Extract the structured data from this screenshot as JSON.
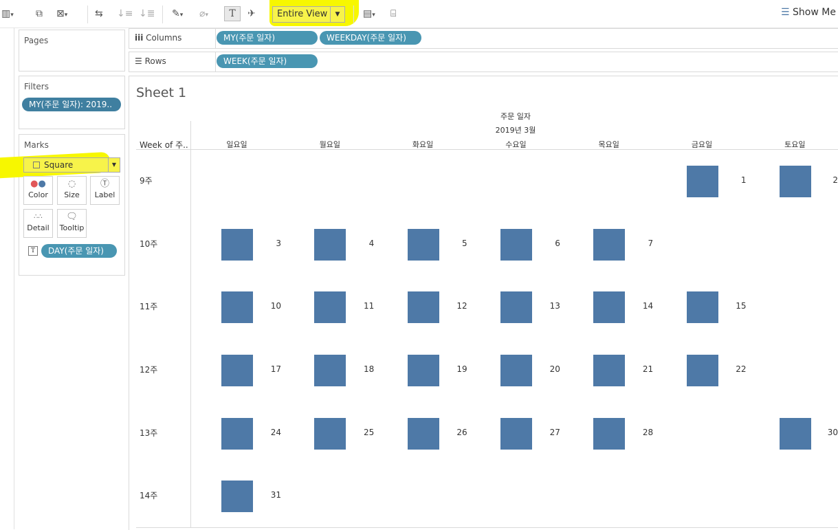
{
  "toolbar": {
    "view_select": "Entire View",
    "show_me": "Show Me",
    "text_icon": "T"
  },
  "pages": {
    "title": "Pages"
  },
  "filters": {
    "title": "Filters",
    "pill": "MY(주문 일자): 2019.."
  },
  "marks": {
    "title": "Marks",
    "type": "Square",
    "buttons": [
      {
        "label": "Color",
        "icon": "color-dots-icon"
      },
      {
        "label": "Size",
        "icon": "size-lasso-icon"
      },
      {
        "label": "Label",
        "icon": "label-T-icon"
      },
      {
        "label": "Detail",
        "icon": "detail-dots-icon"
      },
      {
        "label": "Tooltip",
        "icon": "tooltip-bubble-icon"
      }
    ],
    "label_pill_icon": "T",
    "label_pill": "DAY(주문 일자)"
  },
  "shelves": {
    "columns_label": "Columns",
    "columns": [
      "MY(주문 일자)",
      "WEEKDAY(주문 일자)"
    ],
    "rows_label": "Rows",
    "rows": [
      "WEEK(주문 일자)"
    ]
  },
  "sheet": {
    "title": "Sheet 1",
    "header_top": "주문 일자",
    "header_month": "2019년 3월",
    "row_header": "Week of 주..",
    "weekdays": [
      "일요일",
      "월요일",
      "화요일",
      "수요일",
      "목요일",
      "금요일",
      "토요일"
    ],
    "weeks": [
      "9주",
      "10주",
      "11주",
      "12주",
      "13주",
      "14주"
    ],
    "mark_color": "#4e79a7",
    "cells": [
      {
        "week": 0,
        "day": 5,
        "label": "1"
      },
      {
        "week": 0,
        "day": 6,
        "label": "2"
      },
      {
        "week": 1,
        "day": 0,
        "label": "3"
      },
      {
        "week": 1,
        "day": 1,
        "label": "4"
      },
      {
        "week": 1,
        "day": 2,
        "label": "5"
      },
      {
        "week": 1,
        "day": 3,
        "label": "6"
      },
      {
        "week": 1,
        "day": 4,
        "label": "7"
      },
      {
        "week": 2,
        "day": 0,
        "label": "10"
      },
      {
        "week": 2,
        "day": 1,
        "label": "11"
      },
      {
        "week": 2,
        "day": 2,
        "label": "12"
      },
      {
        "week": 2,
        "day": 3,
        "label": "13"
      },
      {
        "week": 2,
        "day": 4,
        "label": "14"
      },
      {
        "week": 2,
        "day": 5,
        "label": "15"
      },
      {
        "week": 3,
        "day": 0,
        "label": "17"
      },
      {
        "week": 3,
        "day": 1,
        "label": "18"
      },
      {
        "week": 3,
        "day": 2,
        "label": "19"
      },
      {
        "week": 3,
        "day": 3,
        "label": "20"
      },
      {
        "week": 3,
        "day": 4,
        "label": "21"
      },
      {
        "week": 3,
        "day": 5,
        "label": "22"
      },
      {
        "week": 4,
        "day": 0,
        "label": "24"
      },
      {
        "week": 4,
        "day": 1,
        "label": "25"
      },
      {
        "week": 4,
        "day": 2,
        "label": "26"
      },
      {
        "week": 4,
        "day": 3,
        "label": "27"
      },
      {
        "week": 4,
        "day": 4,
        "label": "28"
      },
      {
        "week": 4,
        "day": 6,
        "label": "30"
      },
      {
        "week": 5,
        "day": 0,
        "label": "31"
      }
    ]
  }
}
